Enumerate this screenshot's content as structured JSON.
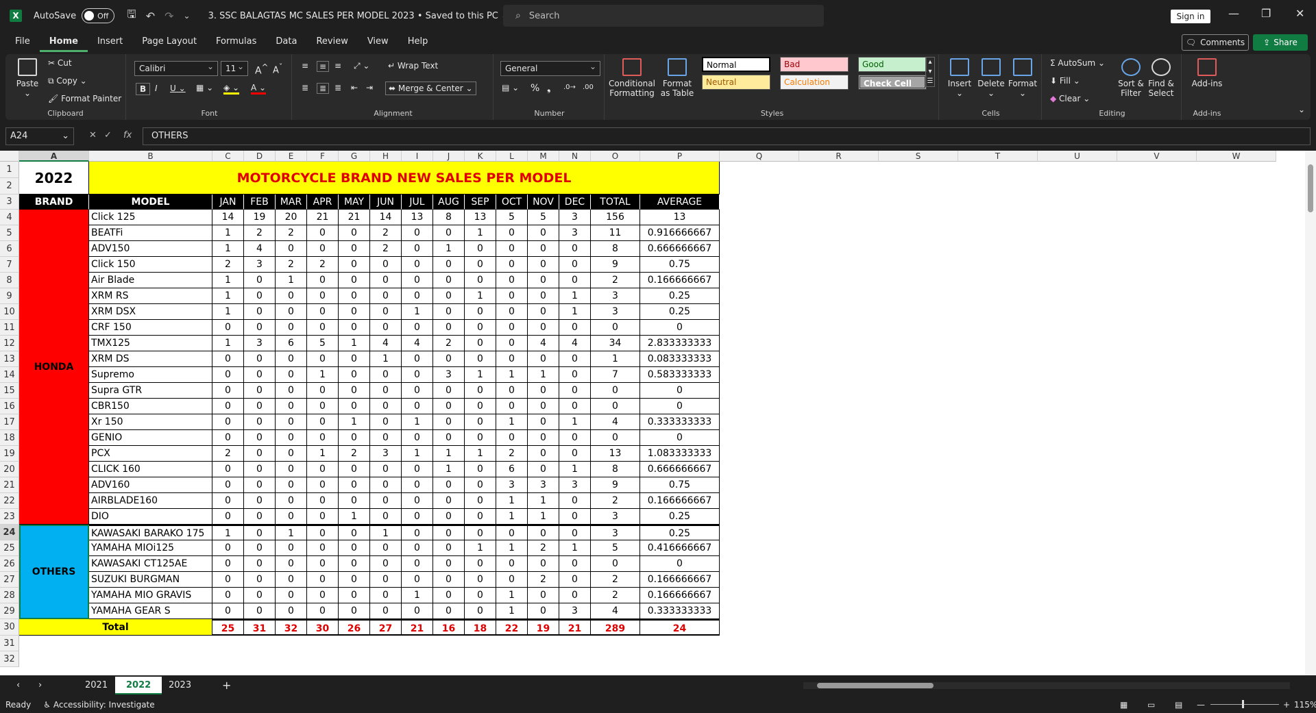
{
  "title_bar": {
    "autosave_label": "AutoSave",
    "autosave_state": "Off",
    "document_title": "3. SSC BALAGTAS MC SALES PER MODEL 2023 • Saved to this PC ⌄",
    "search_placeholder": "Search",
    "sign_in": "Sign in"
  },
  "menu": {
    "tabs": [
      "File",
      "Home",
      "Insert",
      "Page Layout",
      "Formulas",
      "Data",
      "Review",
      "View",
      "Help"
    ],
    "comments": "Comments",
    "share": "Share"
  },
  "ribbon": {
    "clipboard": {
      "paste": "Paste",
      "cut": "Cut",
      "copy": "Copy",
      "format_painter": "Format Painter",
      "label": "Clipboard"
    },
    "font": {
      "name": "Calibri",
      "size": "11",
      "label": "Font"
    },
    "alignment": {
      "wrap_text": "Wrap Text",
      "merge_center": "Merge & Center",
      "label": "Alignment"
    },
    "number": {
      "format": "General",
      "label": "Number"
    },
    "styles": {
      "conditional": "Conditional Formatting",
      "format_table": "Format as Table",
      "cells": [
        {
          "name": "Normal",
          "bg": "#ffffff",
          "fg": "#000000"
        },
        {
          "name": "Bad",
          "bg": "#ffc7ce",
          "fg": "#9c0006"
        },
        {
          "name": "Good",
          "bg": "#c6efce",
          "fg": "#006100"
        },
        {
          "name": "Neutral",
          "bg": "#ffeb9c",
          "fg": "#9c5700"
        },
        {
          "name": "Calculation",
          "bg": "#f2f2f2",
          "fg": "#fa7d00"
        },
        {
          "name": "Check Cell",
          "bg": "#a5a5a5",
          "fg": "#ffffff"
        }
      ],
      "label": "Styles"
    },
    "cells_group": {
      "insert": "Insert",
      "delete": "Delete",
      "format": "Format",
      "label": "Cells"
    },
    "editing": {
      "autosum": "AutoSum",
      "fill": "Fill",
      "clear": "Clear",
      "sort_filter": "Sort & Filter",
      "find_select": "Find & Select",
      "label": "Editing"
    },
    "addins": {
      "addins": "Add-ins",
      "label": "Add-ins"
    }
  },
  "formula_bar": {
    "name_box": "A24",
    "content": "OTHERS"
  },
  "columns": [
    "A",
    "B",
    "C",
    "D",
    "E",
    "F",
    "G",
    "H",
    "I",
    "J",
    "K",
    "L",
    "M",
    "N",
    "O",
    "P",
    "Q",
    "R",
    "S",
    "T",
    "U",
    "V",
    "W"
  ],
  "sheet": {
    "year": "2022",
    "title": "MOTORCYCLE BRAND NEW SALES PER MODEL",
    "headers": [
      "BRAND",
      "MODEL",
      "JAN",
      "FEB",
      "MAR",
      "APR",
      "MAY",
      "JUN",
      "JUL",
      "AUG",
      "SEP",
      "OCT",
      "NOV",
      "DEC",
      "TOTAL",
      "AVERAGE"
    ],
    "brands": [
      {
        "name": "HONDA",
        "color": "#ff0000"
      },
      {
        "name": "OTHERS",
        "color": "#00b0f0"
      }
    ],
    "rows": [
      [
        "Click 125",
        "14",
        "19",
        "20",
        "21",
        "21",
        "14",
        "13",
        "8",
        "13",
        "5",
        "5",
        "3",
        "156",
        "13"
      ],
      [
        "BEATFi",
        "1",
        "2",
        "2",
        "0",
        "0",
        "2",
        "0",
        "0",
        "1",
        "0",
        "0",
        "3",
        "11",
        "0.916666667"
      ],
      [
        "ADV150",
        "1",
        "4",
        "0",
        "0",
        "0",
        "2",
        "0",
        "1",
        "0",
        "0",
        "0",
        "0",
        "8",
        "0.666666667"
      ],
      [
        "Click 150",
        "2",
        "3",
        "2",
        "2",
        "0",
        "0",
        "0",
        "0",
        "0",
        "0",
        "0",
        "0",
        "9",
        "0.75"
      ],
      [
        "Air Blade",
        "1",
        "0",
        "1",
        "0",
        "0",
        "0",
        "0",
        "0",
        "0",
        "0",
        "0",
        "0",
        "2",
        "0.166666667"
      ],
      [
        "XRM RS",
        "1",
        "0",
        "0",
        "0",
        "0",
        "0",
        "0",
        "0",
        "1",
        "0",
        "0",
        "1",
        "3",
        "0.25"
      ],
      [
        "XRM DSX",
        "1",
        "0",
        "0",
        "0",
        "0",
        "0",
        "1",
        "0",
        "0",
        "0",
        "0",
        "1",
        "3",
        "0.25"
      ],
      [
        "CRF 150",
        "0",
        "0",
        "0",
        "0",
        "0",
        "0",
        "0",
        "0",
        "0",
        "0",
        "0",
        "0",
        "0",
        "0"
      ],
      [
        "TMX125",
        "1",
        "3",
        "6",
        "5",
        "1",
        "4",
        "4",
        "2",
        "0",
        "0",
        "4",
        "4",
        "34",
        "2.833333333"
      ],
      [
        "XRM DS",
        "0",
        "0",
        "0",
        "0",
        "0",
        "1",
        "0",
        "0",
        "0",
        "0",
        "0",
        "0",
        "1",
        "0.083333333"
      ],
      [
        "Supremo",
        "0",
        "0",
        "0",
        "1",
        "0",
        "0",
        "0",
        "3",
        "1",
        "1",
        "1",
        "0",
        "7",
        "0.583333333"
      ],
      [
        "Supra GTR",
        "0",
        "0",
        "0",
        "0",
        "0",
        "0",
        "0",
        "0",
        "0",
        "0",
        "0",
        "0",
        "0",
        "0"
      ],
      [
        "CBR150",
        "0",
        "0",
        "0",
        "0",
        "0",
        "0",
        "0",
        "0",
        "0",
        "0",
        "0",
        "0",
        "0",
        "0"
      ],
      [
        "Xr 150",
        "0",
        "0",
        "0",
        "0",
        "1",
        "0",
        "1",
        "0",
        "0",
        "1",
        "0",
        "1",
        "4",
        "0.333333333"
      ],
      [
        "GENIO",
        "0",
        "0",
        "0",
        "0",
        "0",
        "0",
        "0",
        "0",
        "0",
        "0",
        "0",
        "0",
        "0",
        "0"
      ],
      [
        "PCX",
        "2",
        "0",
        "0",
        "1",
        "2",
        "3",
        "1",
        "1",
        "1",
        "2",
        "0",
        "0",
        "13",
        "1.083333333"
      ],
      [
        "CLICK 160",
        "0",
        "0",
        "0",
        "0",
        "0",
        "0",
        "0",
        "1",
        "0",
        "6",
        "0",
        "1",
        "8",
        "0.666666667"
      ],
      [
        "ADV160",
        "0",
        "0",
        "0",
        "0",
        "0",
        "0",
        "0",
        "0",
        "0",
        "3",
        "3",
        "3",
        "9",
        "0.75"
      ],
      [
        "AIRBLADE160",
        "0",
        "0",
        "0",
        "0",
        "0",
        "0",
        "0",
        "0",
        "0",
        "1",
        "1",
        "0",
        "2",
        "0.166666667"
      ],
      [
        "DIO",
        "0",
        "0",
        "0",
        "0",
        "1",
        "0",
        "0",
        "0",
        "0",
        "1",
        "1",
        "0",
        "3",
        "0.25"
      ],
      [
        "KAWASAKI BARAKO 175",
        "1",
        "0",
        "1",
        "0",
        "0",
        "1",
        "0",
        "0",
        "0",
        "0",
        "0",
        "0",
        "3",
        "0.25"
      ],
      [
        "YAMAHA MIOi125",
        "0",
        "0",
        "0",
        "0",
        "0",
        "0",
        "0",
        "0",
        "1",
        "1",
        "2",
        "1",
        "5",
        "0.416666667"
      ],
      [
        "KAWASAKI CT125AE",
        "0",
        "0",
        "0",
        "0",
        "0",
        "0",
        "0",
        "0",
        "0",
        "0",
        "0",
        "0",
        "0",
        "0"
      ],
      [
        "SUZUKI BURGMAN",
        "0",
        "0",
        "0",
        "0",
        "0",
        "0",
        "0",
        "0",
        "0",
        "0",
        "2",
        "0",
        "2",
        "0.166666667"
      ],
      [
        "YAMAHA MIO GRAVIS",
        "0",
        "0",
        "0",
        "0",
        "0",
        "0",
        "1",
        "0",
        "0",
        "1",
        "0",
        "0",
        "2",
        "0.166666667"
      ],
      [
        "YAMAHA GEAR S",
        "0",
        "0",
        "0",
        "0",
        "0",
        "0",
        "0",
        "0",
        "0",
        "1",
        "0",
        "3",
        "4",
        "0.333333333"
      ]
    ],
    "total_label": "Total",
    "totals": [
      "25",
      "31",
      "32",
      "30",
      "26",
      "27",
      "21",
      "16",
      "18",
      "22",
      "19",
      "21",
      "289",
      "24"
    ],
    "row_numbers": [
      "1",
      "2",
      "3",
      "4",
      "5",
      "6",
      "7",
      "8",
      "9",
      "10",
      "11",
      "12",
      "13",
      "14",
      "15",
      "16",
      "17",
      "18",
      "19",
      "20",
      "21",
      "22",
      "23",
      "24",
      "25",
      "26",
      "27",
      "28",
      "29",
      "30",
      "31",
      "32"
    ]
  },
  "sheet_tabs": [
    "2021",
    "2022",
    "2023"
  ],
  "active_sheet": "2022",
  "status": {
    "ready": "Ready",
    "accessibility": "Accessibility: Investigate",
    "zoom": "115%"
  }
}
